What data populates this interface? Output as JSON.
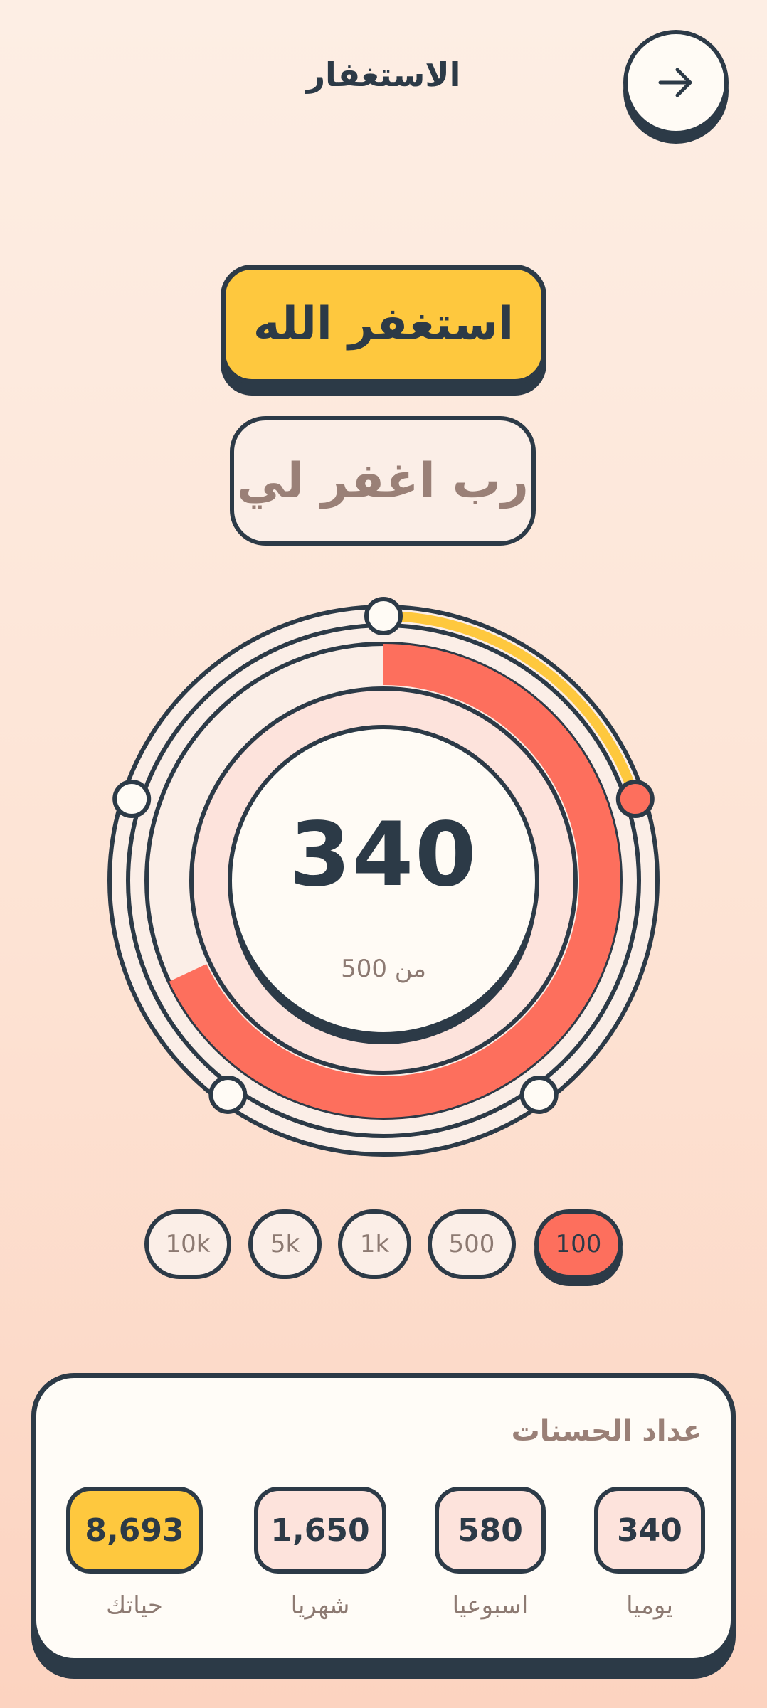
{
  "header": {
    "title": "الاستغفار",
    "back_icon": "arrow-right-icon"
  },
  "dhikr": {
    "primary": "استغفر الله",
    "secondary": "رب اغفر لي"
  },
  "counter": {
    "value": "340",
    "target_label": "من 500",
    "progress_fraction": 0.68,
    "outer_progress_fraction": 0.2
  },
  "targets": [
    {
      "label": "10k",
      "active": false
    },
    {
      "label": "5k",
      "active": false
    },
    {
      "label": "1k",
      "active": false
    },
    {
      "label": "500",
      "active": false
    },
    {
      "label": "100",
      "active": true
    }
  ],
  "stats": {
    "title": "عداد الحسنات",
    "items": [
      {
        "key": "life",
        "value": "8,693",
        "label": "حياتك"
      },
      {
        "key": "monthly",
        "value": "1,650",
        "label": "شهريا"
      },
      {
        "key": "weekly",
        "value": "580",
        "label": "اسبوعيا"
      },
      {
        "key": "daily",
        "value": "340",
        "label": "يوميا"
      }
    ]
  },
  "colors": {
    "navy": "#2c3a47",
    "accent_yellow": "#fec83e",
    "accent_coral": "#fd6f5d",
    "muted_text": "#8d7a72",
    "card": "#fffcf7"
  }
}
